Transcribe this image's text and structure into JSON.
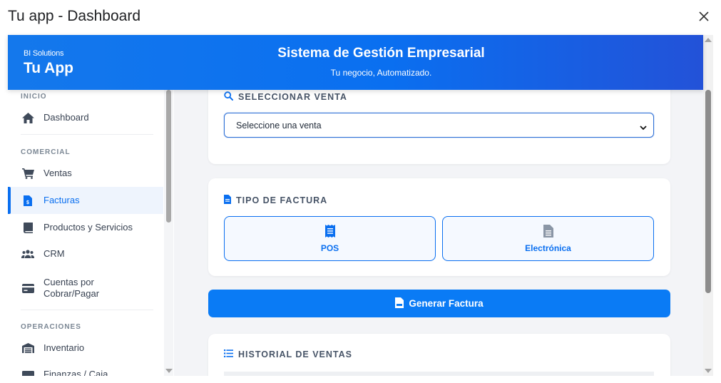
{
  "window": {
    "title": "Tu app - Dashboard"
  },
  "header": {
    "brand_small": "BI Solutions",
    "brand_big": "Tu App",
    "system_title": "Sistema de Gestión Empresarial",
    "system_subtitle": "Tu negocio, Automatizado."
  },
  "sidebar": {
    "sections": {
      "inicio": "INICIO",
      "comercial": "COMERCIAL",
      "operaciones": "OPERACIONES"
    },
    "items": {
      "dashboard": "Dashboard",
      "ventas": "Ventas",
      "facturas": "Facturas",
      "productos": "Productos y Servicios",
      "crm": "CRM",
      "cuentas_1": "Cuentas por",
      "cuentas_2": "Cobrar/Pagar",
      "inventario": "Inventario",
      "finanzas": "Finanzas / Caja"
    },
    "active_item": "Facturas"
  },
  "main": {
    "select_sale": {
      "title": "SELECCIONAR VENTA",
      "selected_value": "Seleccione una venta"
    },
    "invoice_type": {
      "title": "TIPO DE FACTURA",
      "options": {
        "pos": "POS",
        "electronic": "Electrónica"
      }
    },
    "generate_button": "Generar Factura",
    "history": {
      "title": "HISTORIAL DE VENTAS"
    }
  },
  "colors": {
    "accent": "#0a6ff0",
    "header_start": "#1478ec",
    "header_end": "#2352d8",
    "background": "#f3f4f7"
  },
  "icons": [
    "close-icon",
    "home-icon",
    "cart-icon",
    "invoice-icon",
    "book-icon",
    "users-icon",
    "card-icon",
    "warehouse-icon",
    "finance-icon",
    "search-icon",
    "file-icon",
    "receipt-icon",
    "file-lines-icon",
    "file-invoice-icon",
    "list-icon"
  ]
}
